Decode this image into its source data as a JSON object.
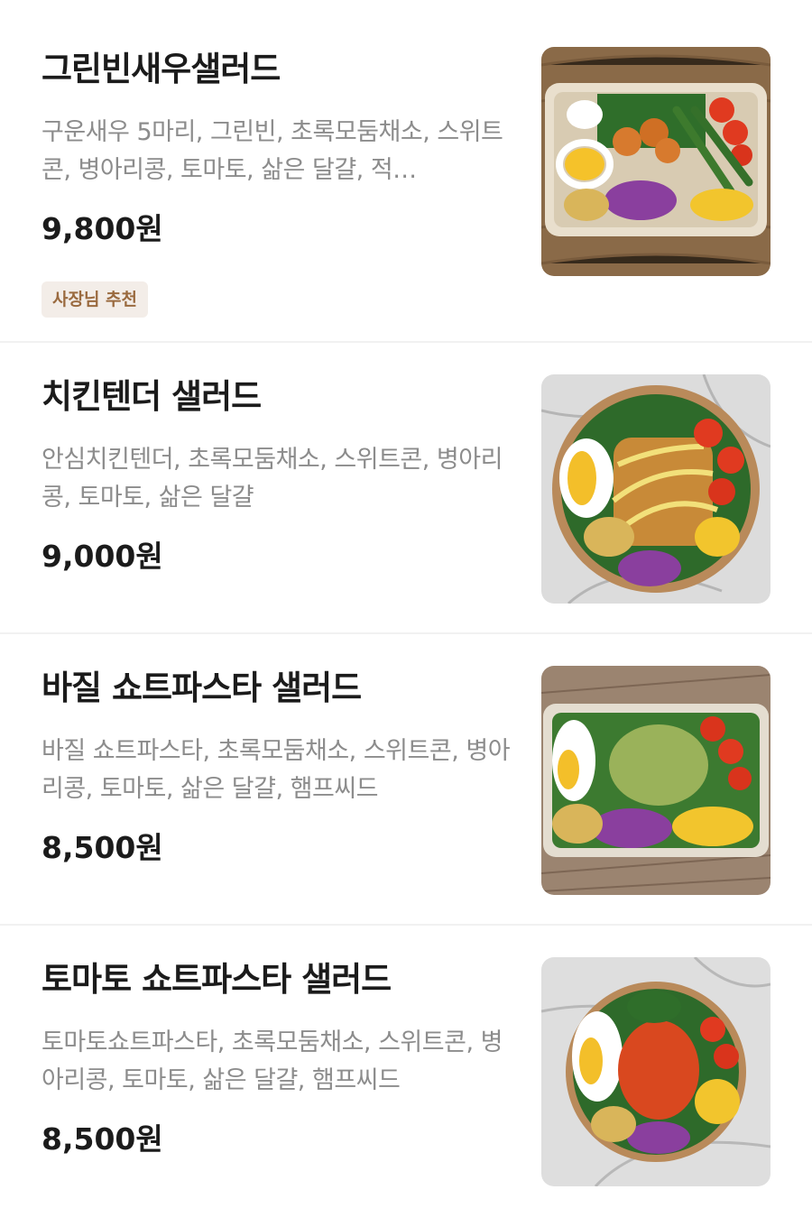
{
  "menu": {
    "items": [
      {
        "name": "그린빈새우샐러드",
        "description": "구운새우 5마리, 그린빈, 초록모둠채소,  스위트콘, 병아리콩, 토마토, 삶은 달걀, 적…",
        "price": "9,800원",
        "badge": "사장님 추천"
      },
      {
        "name": "치킨텐더 샐러드",
        "description": "안심치킨텐더, 초록모둠채소,  스위트콘, 병아리콩, 토마토, 삶은 달걀",
        "price": "9,000원"
      },
      {
        "name": "바질 쇼트파스타 샐러드",
        "description": "바질 쇼트파스타, 초록모둠채소,  스위트콘, 병아리콩, 토마토, 삶은 달걀, 햄프씨드",
        "price": "8,500원"
      },
      {
        "name": "토마토 쇼트파스타 샐러드",
        "description": "토마토쇼트파스타, 초록모둠채소,  스위트콘, 병아리콩, 토마토, 삶은 달걀, 햄프씨드",
        "price": "8,500원"
      }
    ]
  },
  "colors": {
    "description_text": "#8c8c8c",
    "badge_bg": "#f3ede8",
    "badge_text": "#9a6a3f",
    "divider": "#f1f1f1"
  }
}
